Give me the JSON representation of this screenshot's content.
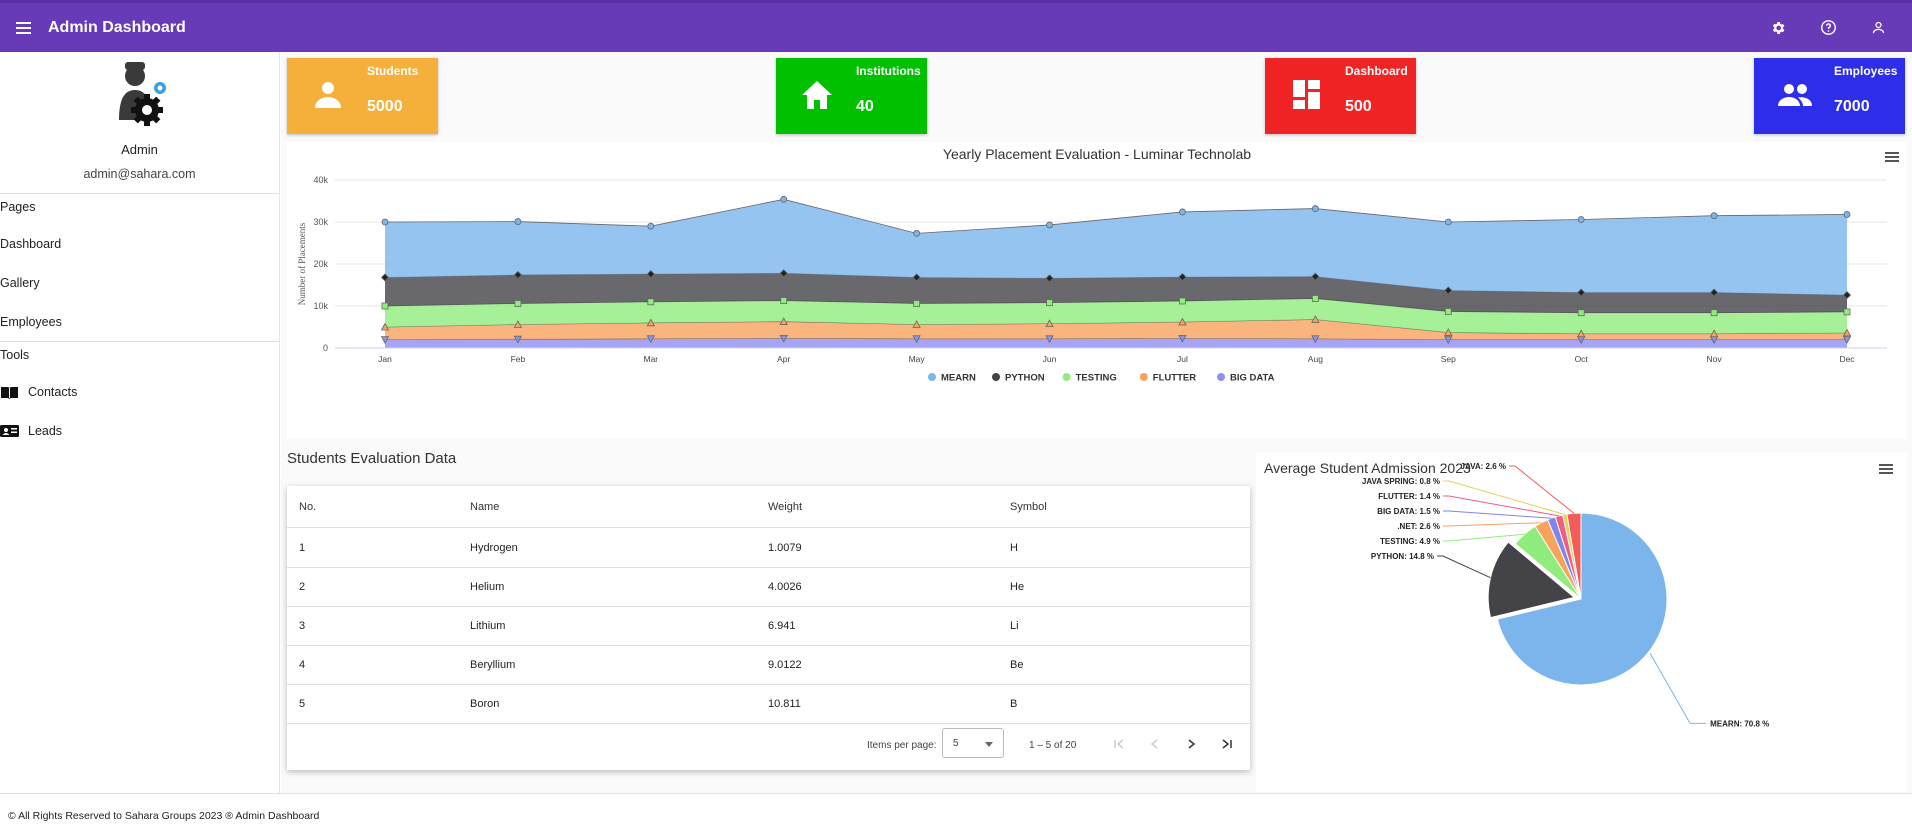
{
  "header": {
    "title": "Admin Dashboard",
    "icons": [
      "menu-icon",
      "settings-icon",
      "help-icon",
      "user-icon"
    ]
  },
  "sidebar": {
    "name": "Admin",
    "email": "admin@sahara.com",
    "pages_title": "Pages",
    "pages": [
      "Dashboard",
      "Gallery",
      "Employees"
    ],
    "tools_title": "Tools",
    "tools": [
      "Contacts",
      "Leads"
    ]
  },
  "cards": [
    {
      "label": "Students",
      "value": "5000",
      "color": "#f4b03a",
      "icon": "person-icon"
    },
    {
      "label": "Institutions",
      "value": "40",
      "color": "#00c000",
      "icon": "home-icon"
    },
    {
      "label": "Dashboard",
      "value": "500",
      "color": "#f02424",
      "icon": "dashboard-icon"
    },
    {
      "label": "Employees",
      "value": "7000",
      "color": "#2d2dea",
      "icon": "people-icon"
    }
  ],
  "chart_data": [
    {
      "type": "area",
      "stacked": true,
      "title": "Yearly Placement Evaluation - Luminar Technolab",
      "ylabel": "Number of Placements",
      "ylim": [
        0,
        40000
      ],
      "yticks": [
        "0",
        "10k",
        "20k",
        "30k",
        "40k"
      ],
      "categories": [
        "Jan",
        "Feb",
        "Mar",
        "Apr",
        "May",
        "Jun",
        "Jul",
        "Aug",
        "Sep",
        "Oct",
        "Nov",
        "Dec"
      ],
      "legend_position": "bottom",
      "series": [
        {
          "name": "BIG DATA",
          "color": "#8f8ff0",
          "values": [
            2000,
            2100,
            2200,
            2300,
            2200,
            2200,
            2300,
            2200,
            2000,
            2000,
            2000,
            2000
          ]
        },
        {
          "name": "FLUTTER",
          "color": "#f7a35c",
          "values": [
            3000,
            3500,
            3800,
            4000,
            3400,
            3600,
            3900,
            4600,
            1700,
            1400,
            1400,
            1600
          ]
        },
        {
          "name": "TESTING",
          "color": "#90ed7d",
          "values": [
            5000,
            5000,
            5000,
            5000,
            5000,
            5000,
            5000,
            5000,
            5000,
            5000,
            5000,
            5000
          ]
        },
        {
          "name": "PYTHON",
          "color": "#434348",
          "values": [
            6800,
            6800,
            6600,
            6500,
            6200,
            5800,
            5700,
            5200,
            5000,
            4800,
            4800,
            4000
          ]
        },
        {
          "name": "MEARN",
          "color": "#7cb5ec",
          "values": [
            13200,
            12700,
            11400,
            17600,
            10500,
            12700,
            15500,
            16200,
            16300,
            17400,
            18300,
            19200
          ]
        }
      ]
    },
    {
      "type": "pie",
      "title": "Average Student Admission 2023",
      "slices": [
        {
          "name": "MEARN",
          "value": 70.8,
          "color": "#7cb5ec",
          "label": "MEARN: 70.8 %"
        },
        {
          "name": "PYTHON",
          "value": 14.8,
          "color": "#434348",
          "label": "PYTHON: 14.8 %"
        },
        {
          "name": "TESTING",
          "value": 4.9,
          "color": "#90ed7d",
          "label": "TESTING: 4.9 %"
        },
        {
          "name": ".NET",
          "value": 2.6,
          "color": "#f7a35c",
          "label": ".NET: 2.6 %"
        },
        {
          "name": "BIG DATA",
          "value": 1.5,
          "color": "#8085e9",
          "label": "BIG DATA: 1.5 %"
        },
        {
          "name": "FLUTTER",
          "value": 1.4,
          "color": "#f15c80",
          "label": "FLUTTER: 1.4 %"
        },
        {
          "name": "JAVA SPRING",
          "value": 0.8,
          "color": "#e4d354",
          "label": "JAVA SPRING: 0.8 %"
        },
        {
          "name": "JAVA",
          "value": 2.6,
          "color": "#f45b5b",
          "label": "JAVA: 2.6 %"
        }
      ]
    }
  ],
  "table": {
    "title": "Students Evaluation Data",
    "headers": [
      "No.",
      "Name",
      "Weight",
      "Symbol"
    ],
    "rows": [
      [
        "1",
        "Hydrogen",
        "1.0079",
        "H"
      ],
      [
        "2",
        "Helium",
        "4.0026",
        "He"
      ],
      [
        "3",
        "Lithium",
        "6.941",
        "Li"
      ],
      [
        "4",
        "Beryllium",
        "9.0122",
        "Be"
      ],
      [
        "5",
        "Boron",
        "10.811",
        "B"
      ]
    ],
    "items_per_page_label": "Items per page:",
    "items_per_page": "5",
    "range": "1 – 5 of 20"
  },
  "footer": {
    "text": "© All Rights Reserved to Sahara Groups 2023 ® Admin Dashboard"
  }
}
